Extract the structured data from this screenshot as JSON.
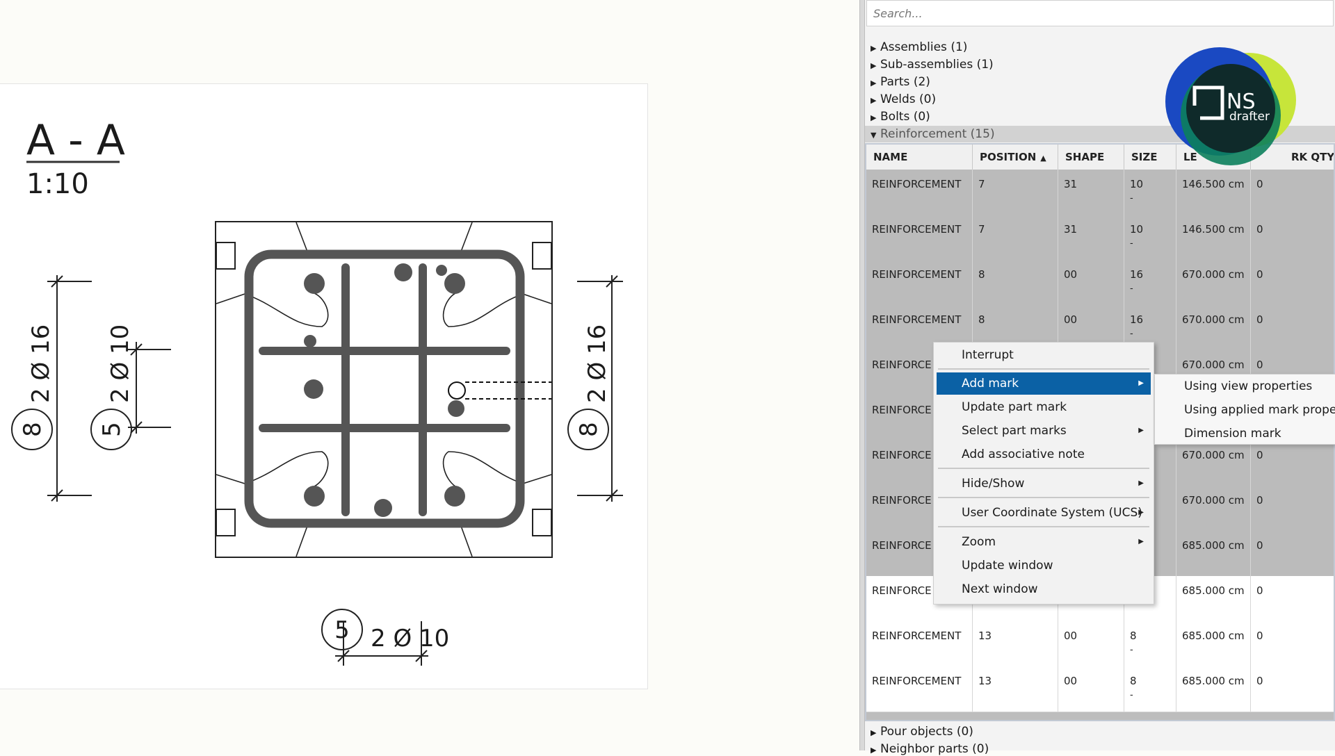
{
  "drawing": {
    "section_title": "A - A",
    "scale": "1:10",
    "dims": {
      "left_outer": {
        "bar_text": "2 Ø 16",
        "position": "8"
      },
      "left_inner": {
        "bar_text": "2 Ø 10",
        "position": "5"
      },
      "right": {
        "bar_text": "2 Ø 16",
        "position": "8"
      },
      "bottom": {
        "bar_text": "2 Ø 10",
        "position": "5"
      }
    }
  },
  "search": {
    "placeholder": "Search..."
  },
  "tree": {
    "assemblies": "Assemblies (1)",
    "sub_assemblies": "Sub-assemblies (1)",
    "parts": "Parts (2)",
    "welds": "Welds (0)",
    "bolts": "Bolts (0)",
    "reinforcement": "Reinforcement (15)",
    "pour_objects": "Pour objects (0)",
    "neighbor_parts": "Neighbor parts (0)"
  },
  "table": {
    "headers": [
      "NAME",
      "POSITION",
      "SHAPE",
      "SIZE",
      "LE",
      "RK QTY"
    ],
    "rows": [
      {
        "name": "REINFORCEMENT",
        "position": "7",
        "shape": "31",
        "size": "10",
        "size_sub": "-",
        "length": "146.500 cm",
        "qty": "0"
      },
      {
        "name": "REINFORCEMENT",
        "position": "7",
        "shape": "31",
        "size": "10",
        "size_sub": "-",
        "length": "146.500 cm",
        "qty": "0"
      },
      {
        "name": "REINFORCEMENT",
        "position": "8",
        "shape": "00",
        "size": "16",
        "size_sub": "-",
        "length": "670.000 cm",
        "qty": "0"
      },
      {
        "name": "REINFORCEMENT",
        "position": "8",
        "shape": "00",
        "size": "16",
        "size_sub": "-",
        "length": "670.000 cm",
        "qty": "0"
      },
      {
        "name": "REINFORCE",
        "position": "",
        "shape": "",
        "size": "",
        "size_sub": "",
        "length": "670.000 cm",
        "qty": "0"
      },
      {
        "name": "REINFORCE",
        "position": "",
        "shape": "",
        "size": "",
        "size_sub": "",
        "length": "",
        "qty": ""
      },
      {
        "name": "REINFORCE",
        "position": "",
        "shape": "",
        "size": "",
        "size_sub": "",
        "length": "670.000 cm",
        "qty": "0"
      },
      {
        "name": "REINFORCE",
        "position": "",
        "shape": "",
        "size": "",
        "size_sub": "",
        "length": "670.000 cm",
        "qty": "0"
      },
      {
        "name": "REINFORCE",
        "position": "",
        "shape": "",
        "size": "",
        "size_sub": "",
        "length": "685.000 cm",
        "qty": "0"
      },
      {
        "name": "REINFORCE",
        "position": "",
        "shape": "",
        "size": "",
        "size_sub": "-",
        "length": "685.000 cm",
        "qty": "0"
      },
      {
        "name": "REINFORCEMENT",
        "position": "13",
        "shape": "00",
        "size": "8",
        "size_sub": "-",
        "length": "685.000 cm",
        "qty": "0"
      },
      {
        "name": "REINFORCEMENT",
        "position": "13",
        "shape": "00",
        "size": "8",
        "size_sub": "-",
        "length": "685.000 cm",
        "qty": "0"
      }
    ]
  },
  "logo": {
    "brand": "NS",
    "sub": "drafter"
  },
  "context_menu": {
    "interrupt": "Interrupt",
    "add_mark": "Add mark",
    "update_part_mark": "Update part mark",
    "select_part_marks": "Select part marks",
    "add_associative_note": "Add associative note",
    "hide_show": "Hide/Show",
    "ucs": "User Coordinate System (UCS)",
    "zoom": "Zoom",
    "update_window": "Update window",
    "next_window": "Next window"
  },
  "submenu": {
    "using_view_properties": "Using view properties",
    "using_applied_mark_properties": "Using applied mark proper",
    "dimension_mark": "Dimension mark"
  },
  "colors": {
    "menu_highlight": "#0b61a5",
    "rebar": "#555555",
    "row_selected": "#bbbbbb"
  }
}
